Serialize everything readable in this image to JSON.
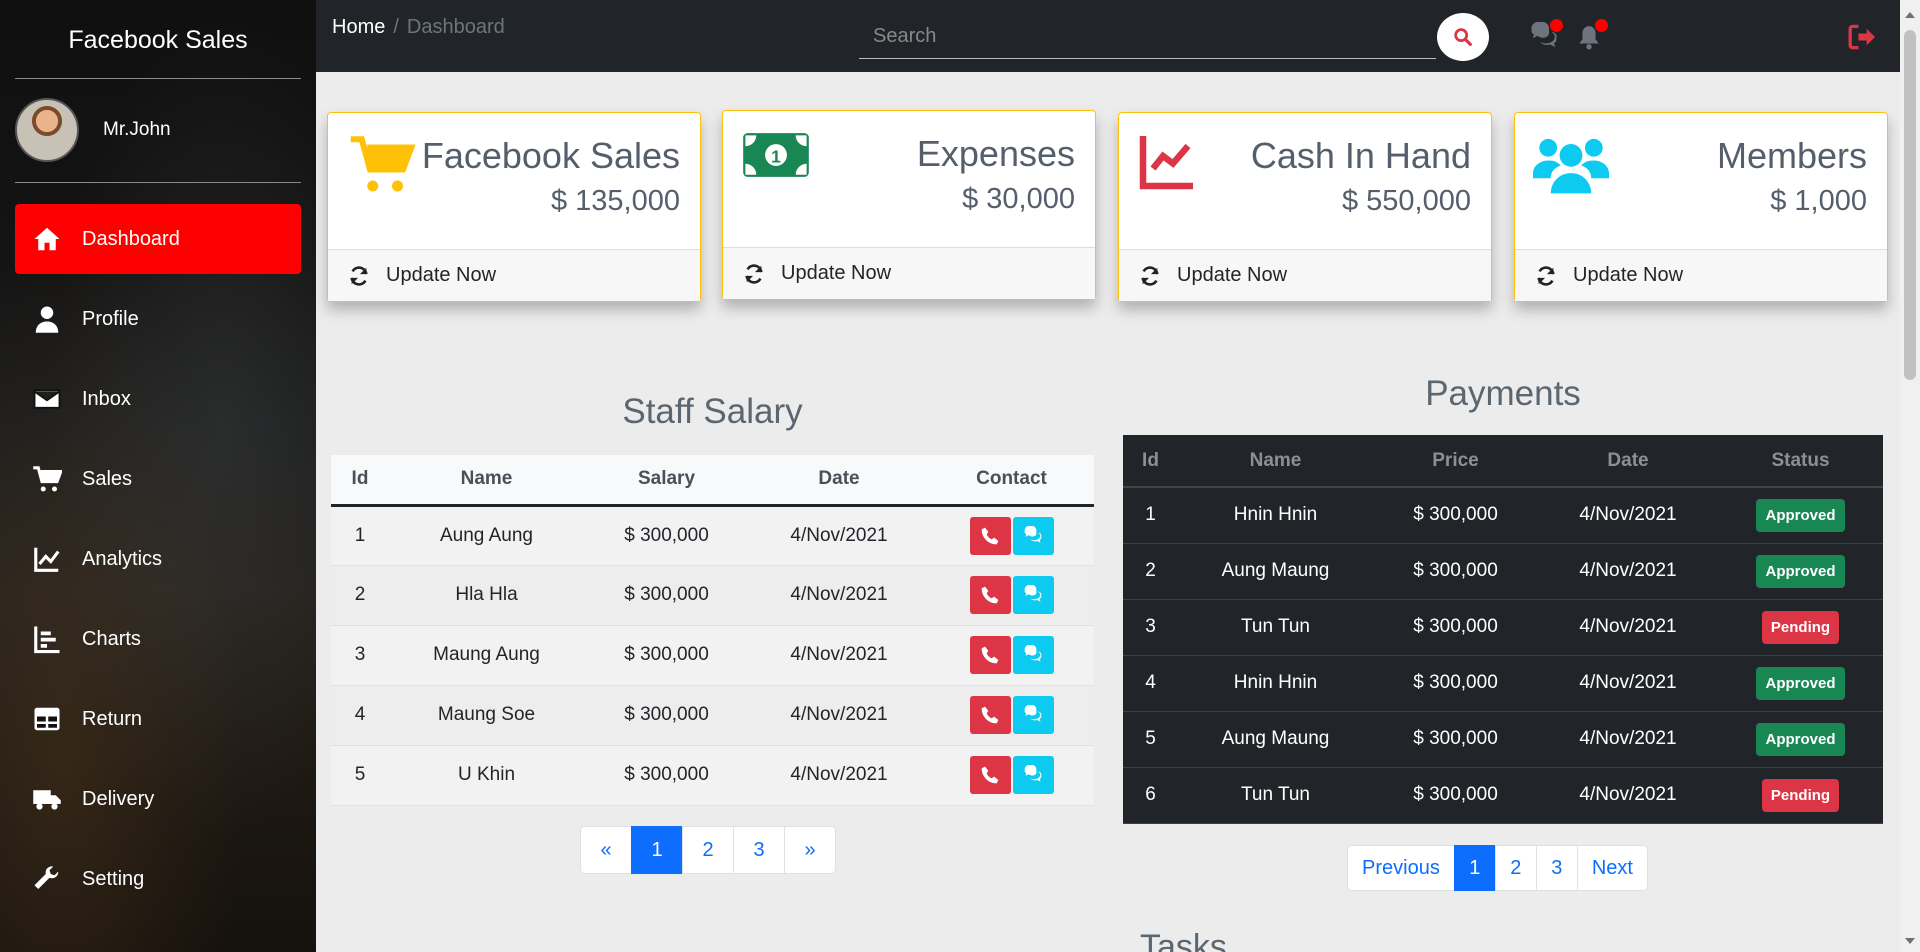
{
  "sidebar": {
    "brand": "Facebook Sales",
    "user_name": "Mr.John",
    "items": [
      {
        "label": "Dashboard",
        "icon": "home-icon"
      },
      {
        "label": "Profile",
        "icon": "user-icon"
      },
      {
        "label": "Inbox",
        "icon": "envelope-icon"
      },
      {
        "label": "Sales",
        "icon": "cart-icon"
      },
      {
        "label": "Analytics",
        "icon": "line-chart-icon"
      },
      {
        "label": "Charts",
        "icon": "bar-chart-icon"
      },
      {
        "label": "Return",
        "icon": "table-icon"
      },
      {
        "label": "Delivery",
        "icon": "truck-icon"
      },
      {
        "label": "Setting",
        "icon": "wrench-icon"
      }
    ]
  },
  "topbar": {
    "breadcrumb_home": "Home",
    "breadcrumb_current": "Dashboard",
    "search_placeholder": "Search"
  },
  "cards": [
    {
      "title": "Facebook Sales",
      "value": "$ 135,000",
      "footer": "Update Now",
      "icon": "cart-icon",
      "color": "#ffc107"
    },
    {
      "title": "Expenses",
      "value": "$ 30,000",
      "footer": "Update Now",
      "icon": "money-bill-icon",
      "color": "#198754"
    },
    {
      "title": "Cash In Hand",
      "value": "$ 550,000",
      "footer": "Update Now",
      "icon": "line-chart-icon",
      "color": "#dc3545"
    },
    {
      "title": "Members",
      "value": "$ 1,000",
      "footer": "Update Now",
      "icon": "users-icon",
      "color": "#0dcaf0"
    }
  ],
  "staff": {
    "title": "Staff Salary",
    "columns": [
      "Id",
      "Name",
      "Salary",
      "Date",
      "Contact"
    ],
    "rows": [
      {
        "id": "1",
        "name": "Aung Aung",
        "salary": "$ 300,000",
        "date": "4/Nov/2021"
      },
      {
        "id": "2",
        "name": "Hla Hla",
        "salary": "$ 300,000",
        "date": "4/Nov/2021"
      },
      {
        "id": "3",
        "name": "Maung Aung",
        "salary": "$ 300,000",
        "date": "4/Nov/2021"
      },
      {
        "id": "4",
        "name": "Maung Soe",
        "salary": "$ 300,000",
        "date": "4/Nov/2021"
      },
      {
        "id": "5",
        "name": "U Khin",
        "salary": "$ 300,000",
        "date": "4/Nov/2021"
      }
    ],
    "pagination": [
      "«",
      "1",
      "2",
      "3",
      "»"
    ]
  },
  "payments": {
    "title": "Payments",
    "columns": [
      "Id",
      "Name",
      "Price",
      "Date",
      "Status"
    ],
    "rows": [
      {
        "id": "1",
        "name": "Hnin Hnin",
        "price": "$ 300,000",
        "date": "4/Nov/2021",
        "status": "Approved"
      },
      {
        "id": "2",
        "name": "Aung Maung",
        "price": "$ 300,000",
        "date": "4/Nov/2021",
        "status": "Approved"
      },
      {
        "id": "3",
        "name": "Tun Tun",
        "price": "$ 300,000",
        "date": "4/Nov/2021",
        "status": "Pending"
      },
      {
        "id": "4",
        "name": "Hnin Hnin",
        "price": "$ 300,000",
        "date": "4/Nov/2021",
        "status": "Approved"
      },
      {
        "id": "5",
        "name": "Aung Maung",
        "price": "$ 300,000",
        "date": "4/Nov/2021",
        "status": "Approved"
      },
      {
        "id": "6",
        "name": "Tun Tun",
        "price": "$ 300,000",
        "date": "4/Nov/2021",
        "status": "Pending"
      }
    ],
    "pagination": [
      "Previous",
      "1",
      "2",
      "3",
      "Next"
    ]
  },
  "next_section_title": "Tasks"
}
